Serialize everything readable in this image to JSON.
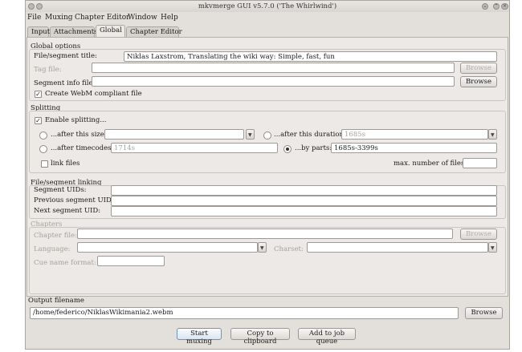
{
  "window": {
    "title": "mkvmerge GUI v5.7.0 ('The Whirlwind')"
  },
  "menu": [
    "File",
    "Muxing",
    "Chapter Editor",
    "Window",
    "Help"
  ],
  "tabs": [
    "Input",
    "Attachments",
    "Global",
    "Chapter Editor"
  ],
  "global_options": {
    "title": "Global options",
    "file_title_label": "File/segment title:",
    "file_title_value": "Niklas Laxstrom, Translating the wiki way: Simple, fast, fun",
    "tag_file_label": "Tag file:",
    "segment_info_label": "Segment info file:",
    "browse": "Browse",
    "webm_label": "Create WebM compliant file",
    "webm_check": "✓"
  },
  "splitting": {
    "title": "Splitting",
    "enable_label": "Enable splitting...",
    "enable_check": "✓",
    "after_size_label": "...after this size:",
    "after_duration_label": "...after this duration:",
    "after_duration_value": "1685s",
    "after_timecodes_label": "...after timecodes:",
    "after_timecodes_value": "1714s",
    "by_parts_label": "...by parts:",
    "by_parts_value": "1685s-3399s",
    "link_files_label": "link files",
    "max_files_label": "max. number of files:"
  },
  "linking": {
    "title": "File/segment linking",
    "segment_uids": "Segment UIDs:",
    "prev_uid": "Previous segment UID:",
    "next_uid": "Next segment UID:"
  },
  "chapters": {
    "title": "Chapters",
    "chapter_file": "Chapter file:",
    "language": "Language:",
    "charset": "Charset:",
    "cue_name_format": "Cue name format:"
  },
  "output": {
    "title": "Output filename",
    "value": "/home/federico/NiklasWikimania2.webm",
    "browse": "Browse"
  },
  "actions": {
    "start": "Start muxing",
    "copy": "Copy to clipboard",
    "add_queue": "Add to job queue"
  },
  "icons": {
    "app": "app-icon",
    "minimize": "minimize-icon",
    "close": "close-icon",
    "dropdown": "chevron-down-icon",
    "check": "check-icon"
  }
}
